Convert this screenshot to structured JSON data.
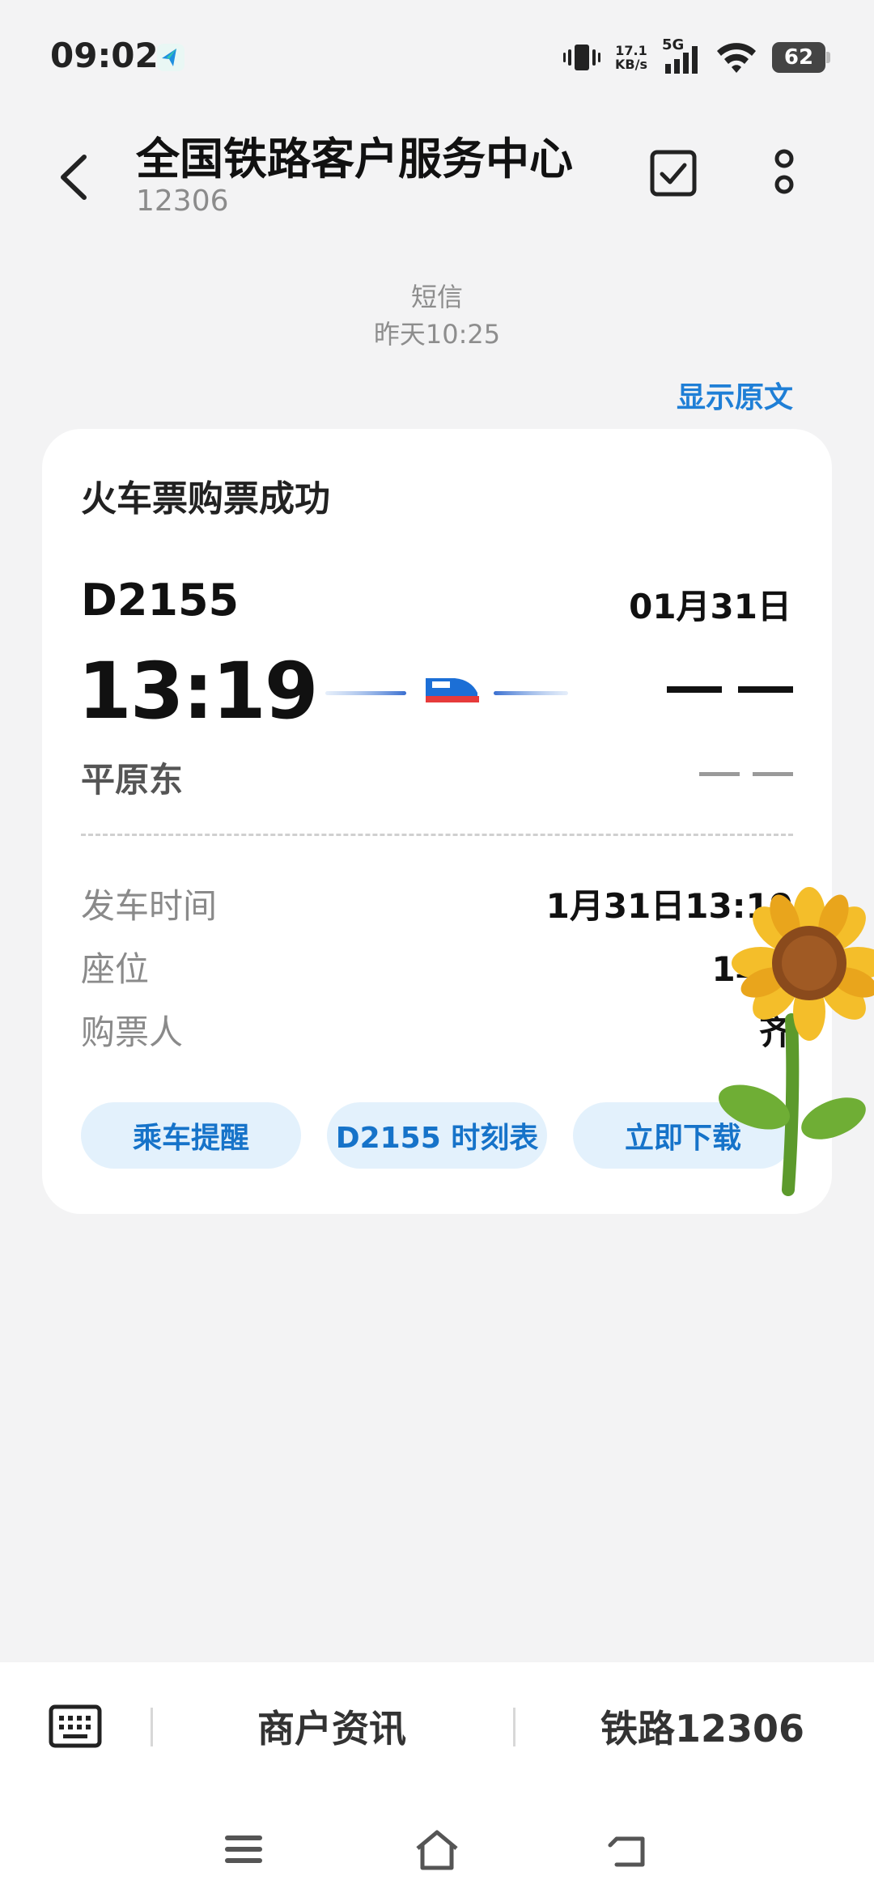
{
  "status_bar": {
    "time": "09:02",
    "net_speed_value": "17.1",
    "net_speed_unit": "KB/s",
    "network_type": "5G",
    "battery": "62"
  },
  "header": {
    "title": "全国铁路客户服务中心",
    "subtitle": "12306"
  },
  "message_meta": {
    "type": "短信",
    "timestamp": "昨天10:25",
    "show_original": "显示原文"
  },
  "ticket_card": {
    "title": "火车票购票成功",
    "train_number": "D2155",
    "date": "01月31日",
    "departure_time": "13:19",
    "departure_station": "平原东",
    "details": [
      {
        "label": "发车时间",
        "value": "1月31日13:19"
      },
      {
        "label": "座位",
        "value": "1车7"
      },
      {
        "label": "购票人",
        "value": "齐"
      }
    ],
    "actions": [
      "乘车提醒",
      "D2155 时刻表",
      "立即下载"
    ]
  },
  "bottom_menu": {
    "items": [
      "商户资讯",
      "铁路12306"
    ]
  },
  "colors": {
    "accent": "#1f7fd6",
    "pill_bg": "#e3f1fc",
    "background": "#f3f3f4"
  }
}
